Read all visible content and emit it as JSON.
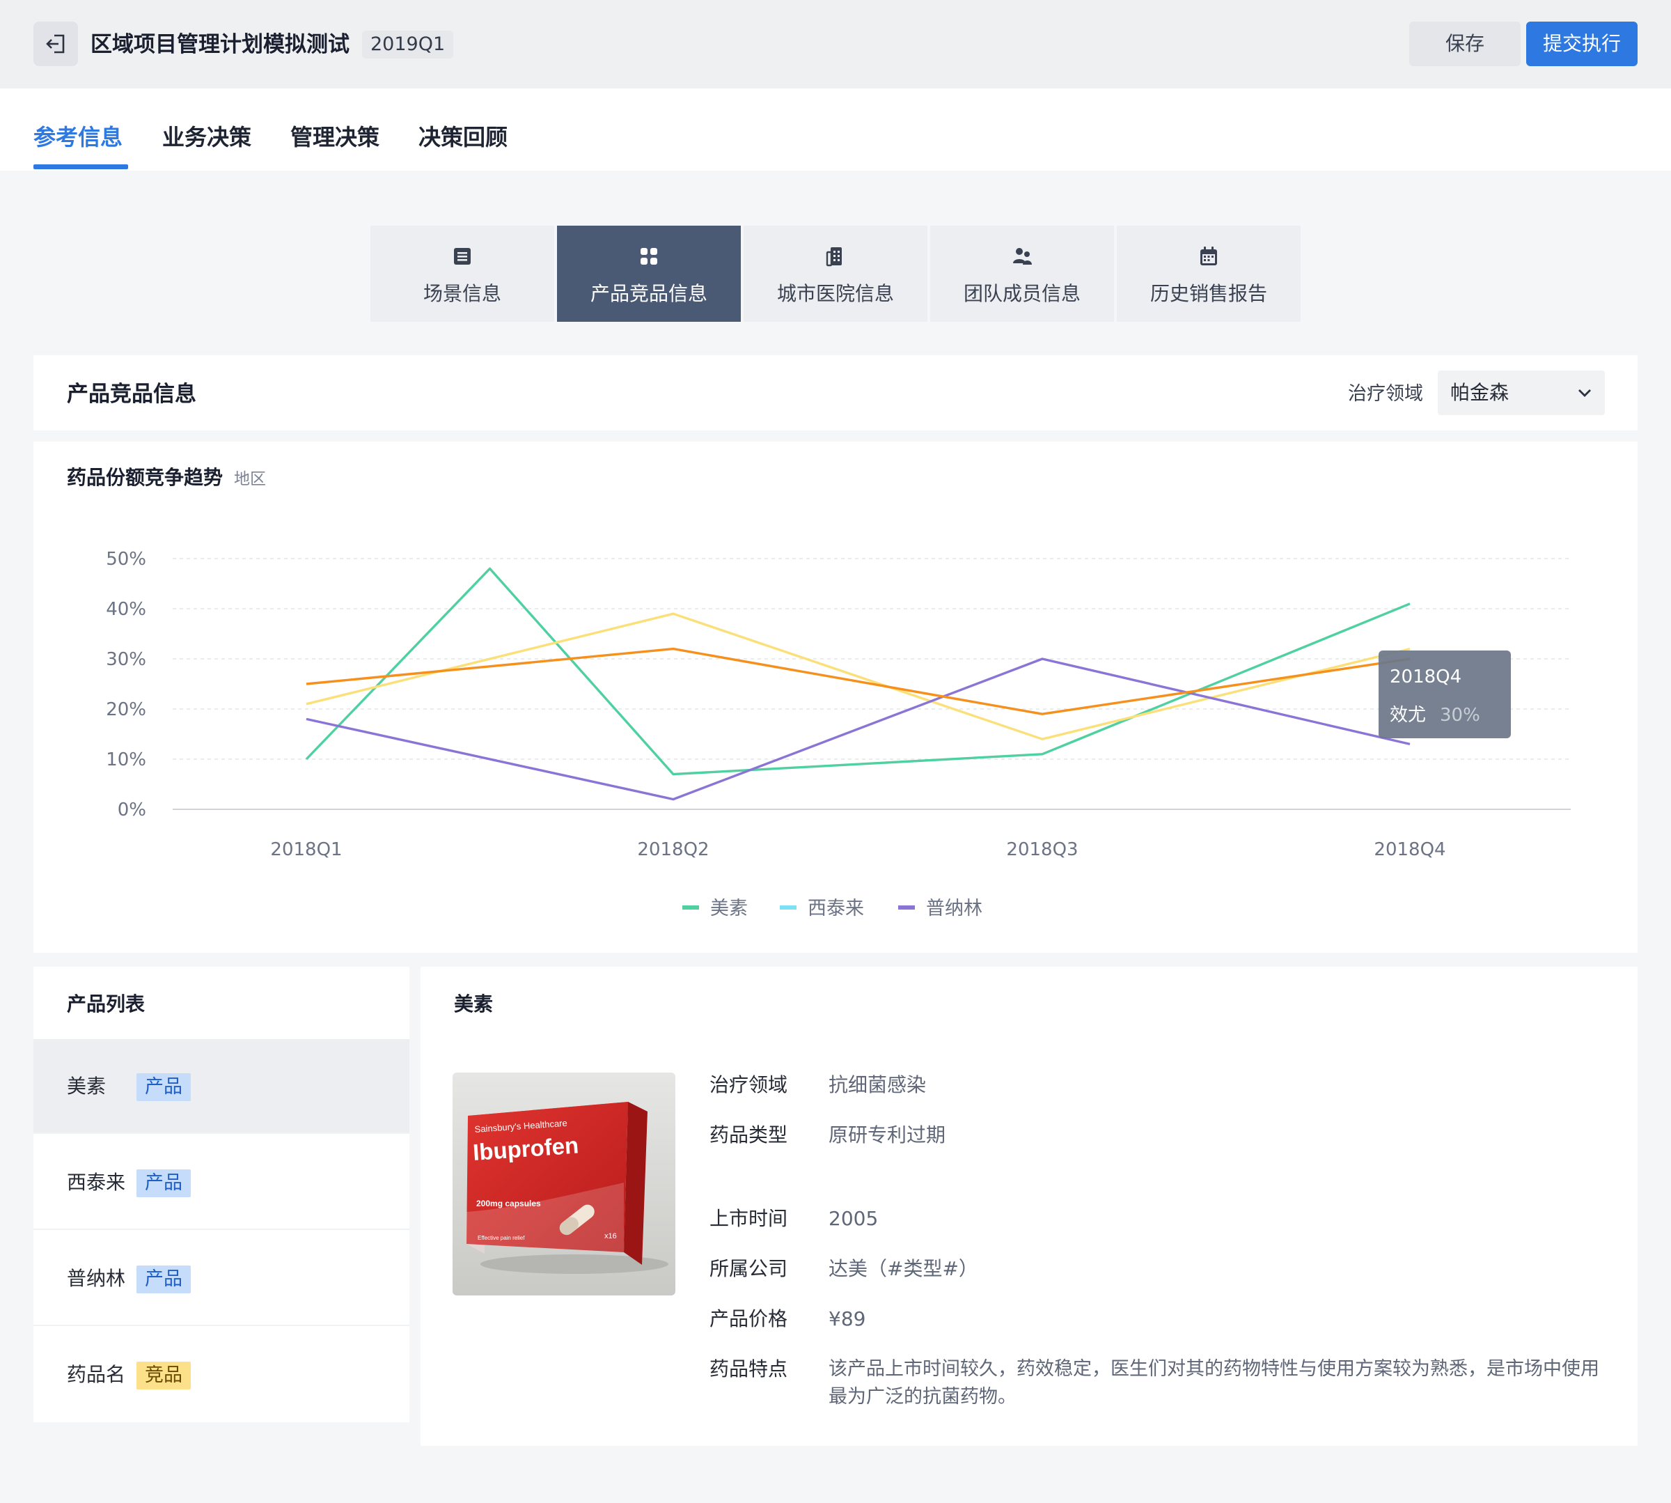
{
  "header": {
    "title": "区域项目管理计划模拟测试",
    "period": "2019Q1",
    "save_label": "保存",
    "submit_label": "提交执行"
  },
  "tabs": [
    {
      "label": "参考信息",
      "active": true
    },
    {
      "label": "业务决策",
      "active": false
    },
    {
      "label": "管理决策",
      "active": false
    },
    {
      "label": "决策回顾",
      "active": false
    }
  ],
  "segments": [
    {
      "label": "场景信息",
      "icon": "list-icon",
      "active": false
    },
    {
      "label": "产品竞品信息",
      "icon": "grid-icon",
      "active": true
    },
    {
      "label": "城市医院信息",
      "icon": "building-icon",
      "active": false
    },
    {
      "label": "团队成员信息",
      "icon": "team-icon",
      "active": false
    },
    {
      "label": "历史销售报告",
      "icon": "calendar-icon",
      "active": false
    }
  ],
  "section": {
    "title": "产品竞品信息",
    "filter_label": "治疗领域",
    "filter_value": "帕金森"
  },
  "chart": {
    "title": "药品份额竞争趋势",
    "subtitle": "地区",
    "tooltip": {
      "title": "2018Q4",
      "series": "效尤",
      "value": "30%"
    }
  },
  "chart_data": {
    "type": "line",
    "categories": [
      "2018Q1",
      "2018Q2",
      "2018Q3",
      "2018Q4"
    ],
    "y_ticks": [
      "0%",
      "10%",
      "20%",
      "30%",
      "40%",
      "50%"
    ],
    "ylim": [
      0,
      50
    ],
    "grid": true,
    "legend_position": "bottom",
    "series": [
      {
        "name": "美素",
        "color": "#4fd0a0",
        "legend": true,
        "x": [
          0,
          0.5,
          1,
          2,
          3
        ],
        "values": [
          10,
          48,
          7,
          11,
          41
        ]
      },
      {
        "name": "西泰来",
        "color": "#fbe07a",
        "legend_color": "#7ee0f5",
        "legend": true,
        "x": [
          0,
          1,
          2,
          3
        ],
        "values": [
          21,
          39,
          14,
          32
        ]
      },
      {
        "name": "普纳林",
        "color": "#8a74d6",
        "legend": true,
        "x": [
          0,
          1,
          2,
          3
        ],
        "values": [
          18,
          2,
          30,
          13
        ]
      },
      {
        "name": "效尤",
        "color": "#f5901d",
        "legend": false,
        "x": [
          0,
          1,
          2,
          3
        ],
        "values": [
          25,
          32,
          19,
          30
        ]
      }
    ]
  },
  "product_list": {
    "title": "产品列表",
    "items": [
      {
        "name": "美素",
        "badge": "产品",
        "badge_type": "product",
        "active": true
      },
      {
        "name": "西泰来",
        "badge": "产品",
        "badge_type": "product",
        "active": false
      },
      {
        "name": "普纳林",
        "badge": "产品",
        "badge_type": "product",
        "active": false
      },
      {
        "name": "药品名",
        "badge": "竞品",
        "badge_type": "competitor",
        "active": false
      }
    ]
  },
  "product_detail": {
    "title": "美素",
    "image": {
      "brand": "Sainsbury's Healthcare",
      "name": "Ibuprofen",
      "dose": "200mg capsules",
      "count": "x16",
      "note": "Effective pain relief"
    },
    "fields": [
      {
        "label": "治疗领域",
        "value": "抗细菌感染"
      },
      {
        "label": "药品类型",
        "value": "原研专利过期"
      },
      {
        "label": "上市时间",
        "value": "2005"
      },
      {
        "label": "所属公司",
        "value": "达美（#类型#）"
      },
      {
        "label": "产品价格",
        "value": "¥89"
      },
      {
        "label": "药品特点",
        "value": "该产品上市时间较久，药效稳定，医生们对其的药物特性与使用方案较为熟悉，是市场中使用最为广泛的抗菌药物。"
      }
    ]
  }
}
